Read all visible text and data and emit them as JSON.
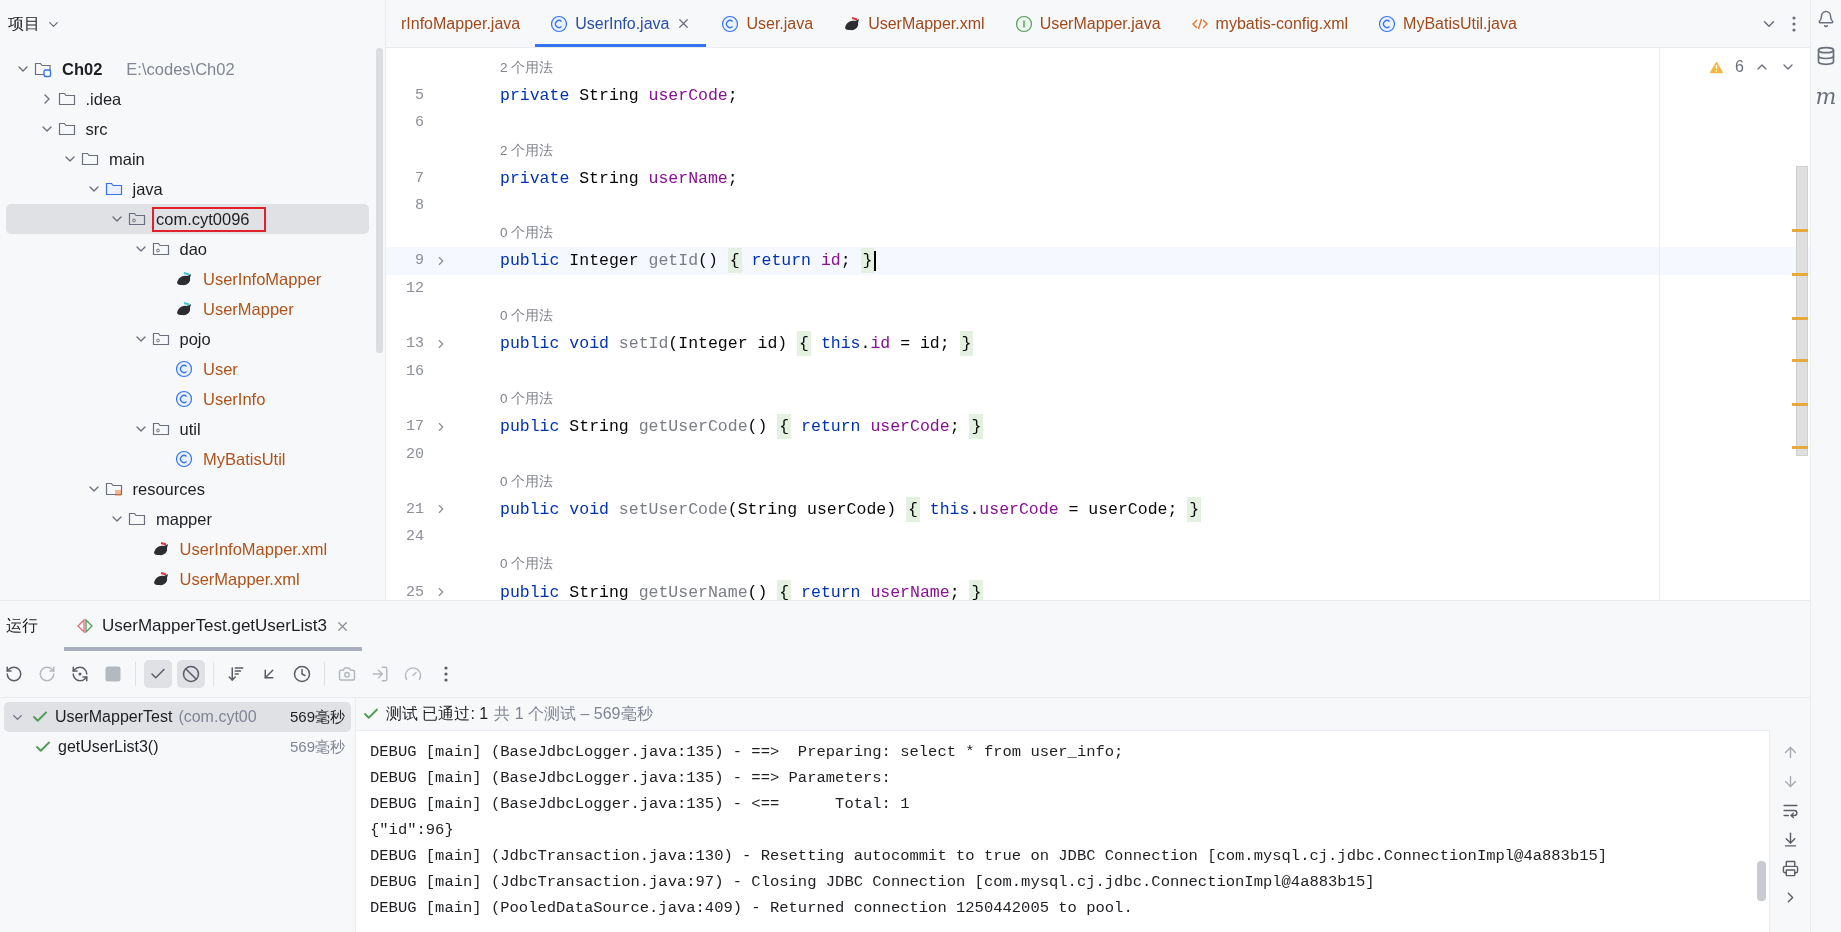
{
  "project_panel": {
    "title": "项目",
    "tree": [
      {
        "name": "Ch02",
        "path": "E:\\codes\\Ch02",
        "kind": "module",
        "expanded": true,
        "selected": false,
        "children": [
          {
            "name": ".idea",
            "kind": "folder",
            "expanded": false,
            "selected": false
          },
          {
            "name": "src",
            "kind": "folder",
            "expanded": true,
            "selected": false,
            "children": [
              {
                "name": "main",
                "kind": "folder",
                "expanded": true,
                "selected": false,
                "children": [
                  {
                    "name": "java",
                    "kind": "source-folder",
                    "expanded": true,
                    "selected": false,
                    "children": [
                      {
                        "name": "com.cyt0096",
                        "kind": "package",
                        "expanded": true,
                        "selected": true,
                        "marked": true,
                        "children": [
                          {
                            "name": "dao",
                            "kind": "package",
                            "expanded": true,
                            "selected": false,
                            "children": [
                              {
                                "name": "UserInfoMapper",
                                "kind": "mapper",
                                "selected": false
                              },
                              {
                                "name": "UserMapper",
                                "kind": "mapper",
                                "selected": false
                              }
                            ]
                          },
                          {
                            "name": "pojo",
                            "kind": "package",
                            "expanded": true,
                            "selected": false,
                            "children": [
                              {
                                "name": "User",
                                "kind": "class",
                                "selected": false
                              },
                              {
                                "name": "UserInfo",
                                "kind": "class",
                                "selected": false
                              }
                            ]
                          },
                          {
                            "name": "util",
                            "kind": "package",
                            "expanded": true,
                            "selected": false,
                            "children": [
                              {
                                "name": "MyBatisUtil",
                                "kind": "class",
                                "selected": false
                              }
                            ]
                          }
                        ]
                      }
                    ]
                  },
                  {
                    "name": "resources",
                    "kind": "resources-folder",
                    "expanded": true,
                    "selected": false,
                    "children": [
                      {
                        "name": "mapper",
                        "kind": "folder",
                        "expanded": true,
                        "selected": false,
                        "children": [
                          {
                            "name": "UserInfoMapper.xml",
                            "kind": "mapper-xml",
                            "selected": false
                          },
                          {
                            "name": "UserMapper.xml",
                            "kind": "mapper-xml",
                            "selected": false
                          }
                        ]
                      }
                    ]
                  }
                ]
              }
            ]
          }
        ]
      }
    ]
  },
  "editor": {
    "tabs": [
      {
        "label": "rInfoMapper.java",
        "selected": false
      },
      {
        "label": "UserInfo.java",
        "kind": "class",
        "selected": true
      },
      {
        "label": "User.java",
        "kind": "class",
        "selected": false
      },
      {
        "label": "UserMapper.xml",
        "kind": "mapper-xml",
        "selected": false
      },
      {
        "label": "UserMapper.java",
        "kind": "interface",
        "selected": false
      },
      {
        "label": "mybatis-config.xml",
        "kind": "xml",
        "selected": false
      },
      {
        "label": "MyBatisUtil.java",
        "kind": "class",
        "selected": false
      }
    ],
    "warnings": "6",
    "lines": [
      {
        "kind": "hint",
        "text": "2 个用法"
      },
      {
        "kind": "code",
        "number": "5",
        "folded": false,
        "current": false,
        "tokens": [
          {
            "text": "private",
            "kind": "keyword"
          },
          {
            "text": " String ",
            "kind": "plain"
          },
          {
            "text": "userCode",
            "kind": "field"
          },
          {
            "text": ";",
            "kind": "plain"
          }
        ]
      },
      {
        "kind": "blank",
        "number": "6"
      },
      {
        "kind": "hint",
        "text": "2 个用法"
      },
      {
        "kind": "code",
        "number": "7",
        "folded": false,
        "current": false,
        "tokens": [
          {
            "text": "private",
            "kind": "keyword"
          },
          {
            "text": " String ",
            "kind": "plain"
          },
          {
            "text": "userName",
            "kind": "field"
          },
          {
            "text": ";",
            "kind": "plain"
          }
        ]
      },
      {
        "kind": "blank",
        "number": "8"
      },
      {
        "kind": "hint",
        "text": "0 个用法"
      },
      {
        "kind": "code",
        "number": "9",
        "folded": true,
        "current": true,
        "tokens": [
          {
            "text": "public",
            "kind": "keyword"
          },
          {
            "text": " Integer ",
            "kind": "plain"
          },
          {
            "text": "getId",
            "kind": "unused"
          },
          {
            "text": "() ",
            "kind": "plain"
          },
          {
            "text": "{",
            "kind": "brace"
          },
          {
            "text": " return",
            "kind": "keyword"
          },
          {
            "text": " id",
            "kind": "field"
          },
          {
            "text": "; ",
            "kind": "plain"
          },
          {
            "text": "}",
            "kind": "brace"
          }
        ]
      },
      {
        "kind": "blank",
        "number": "12"
      },
      {
        "kind": "hint",
        "text": "0 个用法"
      },
      {
        "kind": "code",
        "number": "13",
        "folded": true,
        "current": false,
        "tokens": [
          {
            "text": "public",
            "kind": "keyword"
          },
          {
            "text": " void",
            "kind": "keyword"
          },
          {
            "text": " setId",
            "kind": "unused"
          },
          {
            "text": "(Integer id) ",
            "kind": "plain"
          },
          {
            "text": "{",
            "kind": "brace"
          },
          {
            "text": " this",
            "kind": "keyword"
          },
          {
            "text": ".",
            "kind": "plain"
          },
          {
            "text": "id",
            "kind": "field"
          },
          {
            "text": " = id; ",
            "kind": "plain"
          },
          {
            "text": "}",
            "kind": "brace"
          }
        ]
      },
      {
        "kind": "blank",
        "number": "16"
      },
      {
        "kind": "hint",
        "text": "0 个用法"
      },
      {
        "kind": "code",
        "number": "17",
        "folded": true,
        "current": false,
        "tokens": [
          {
            "text": "public",
            "kind": "keyword"
          },
          {
            "text": " String ",
            "kind": "plain"
          },
          {
            "text": "getUserCode",
            "kind": "unused"
          },
          {
            "text": "() ",
            "kind": "plain"
          },
          {
            "text": "{",
            "kind": "brace"
          },
          {
            "text": " return",
            "kind": "keyword"
          },
          {
            "text": " userCode",
            "kind": "field"
          },
          {
            "text": "; ",
            "kind": "plain"
          },
          {
            "text": "}",
            "kind": "brace"
          }
        ]
      },
      {
        "kind": "blank",
        "number": "20"
      },
      {
        "kind": "hint",
        "text": "0 个用法"
      },
      {
        "kind": "code",
        "number": "21",
        "folded": true,
        "current": false,
        "tokens": [
          {
            "text": "public",
            "kind": "keyword"
          },
          {
            "text": " void",
            "kind": "keyword"
          },
          {
            "text": " setUserCode",
            "kind": "unused"
          },
          {
            "text": "(String userCode) ",
            "kind": "plain"
          },
          {
            "text": "{",
            "kind": "brace"
          },
          {
            "text": " this",
            "kind": "keyword"
          },
          {
            "text": ".",
            "kind": "plain"
          },
          {
            "text": "userCode",
            "kind": "field"
          },
          {
            "text": " = userCode; ",
            "kind": "plain"
          },
          {
            "text": "}",
            "kind": "brace"
          }
        ]
      },
      {
        "kind": "blank",
        "number": "24"
      },
      {
        "kind": "hint",
        "text": "0 个用法"
      },
      {
        "kind": "code",
        "number": "25",
        "folded": true,
        "current": false,
        "tokens": [
          {
            "text": "public",
            "kind": "keyword"
          },
          {
            "text": " String ",
            "kind": "plain"
          },
          {
            "text": "getUserName",
            "kind": "unused"
          },
          {
            "text": "() ",
            "kind": "plain"
          },
          {
            "text": "{",
            "kind": "brace"
          },
          {
            "text": " return",
            "kind": "keyword"
          },
          {
            "text": " userName",
            "kind": "field"
          },
          {
            "text": "; ",
            "kind": "plain"
          },
          {
            "text": "}",
            "kind": "brace"
          }
        ]
      }
    ]
  },
  "run_panel": {
    "title": "运行",
    "tab": "UserMapperTest.getUserList3",
    "toolbar": [
      {
        "kind": "rerun",
        "selected": false,
        "disabled": false
      },
      {
        "kind": "rerun-failed",
        "selected": false,
        "disabled": true
      },
      {
        "kind": "toggle-auto",
        "selected": false,
        "disabled": false
      },
      {
        "kind": "stop",
        "selected": false,
        "disabled": true
      },
      {
        "kind": "show-passed",
        "selected": true,
        "disabled": false
      },
      {
        "kind": "show-ignored",
        "selected": true,
        "disabled": false
      },
      {
        "kind": "sort",
        "selected": false,
        "disabled": false
      },
      {
        "kind": "import",
        "selected": false,
        "disabled": false
      },
      {
        "kind": "history",
        "selected": false,
        "disabled": false
      },
      {
        "kind": "snapshot",
        "selected": false,
        "disabled": true
      },
      {
        "kind": "export",
        "selected": false,
        "disabled": true
      },
      {
        "kind": "coverage",
        "selected": false,
        "disabled": true
      },
      {
        "kind": "more",
        "selected": false,
        "disabled": false
      }
    ],
    "tests": [
      {
        "name": "UserMapperTest",
        "detail": "(com.cyt00",
        "time": "569毫秒",
        "passed": true,
        "selected": true,
        "expanded": true,
        "children": [
          {
            "name": "getUserList3()",
            "time": "569毫秒",
            "passed": true,
            "selected": false
          }
        ]
      }
    ],
    "status": {
      "passed": "测试 已通过: 1",
      "summary": "共 1 个测试 – 569毫秒"
    },
    "console": [
      "DEBUG [main] (BaseJdbcLogger.java:135) - ==>  Preparing: select * from user_info;",
      "DEBUG [main] (BaseJdbcLogger.java:135) - ==> Parameters:",
      "DEBUG [main] (BaseJdbcLogger.java:135) - <==      Total: 1",
      "{\"id\":96}",
      "DEBUG [main] (JdbcTransaction.java:130) - Resetting autocommit to true on JDBC Connection [com.mysql.cj.jdbc.ConnectionImpl@4a883b15]",
      "DEBUG [main] (JdbcTransaction.java:97) - Closing JDBC Connection [com.mysql.cj.jdbc.ConnectionImpl@4a883b15]",
      "DEBUG [main] (PooledDataSource.java:409) - Returned connection 1250442005 to pool."
    ]
  },
  "right_toolbar": {
    "maven_label": "m"
  }
}
